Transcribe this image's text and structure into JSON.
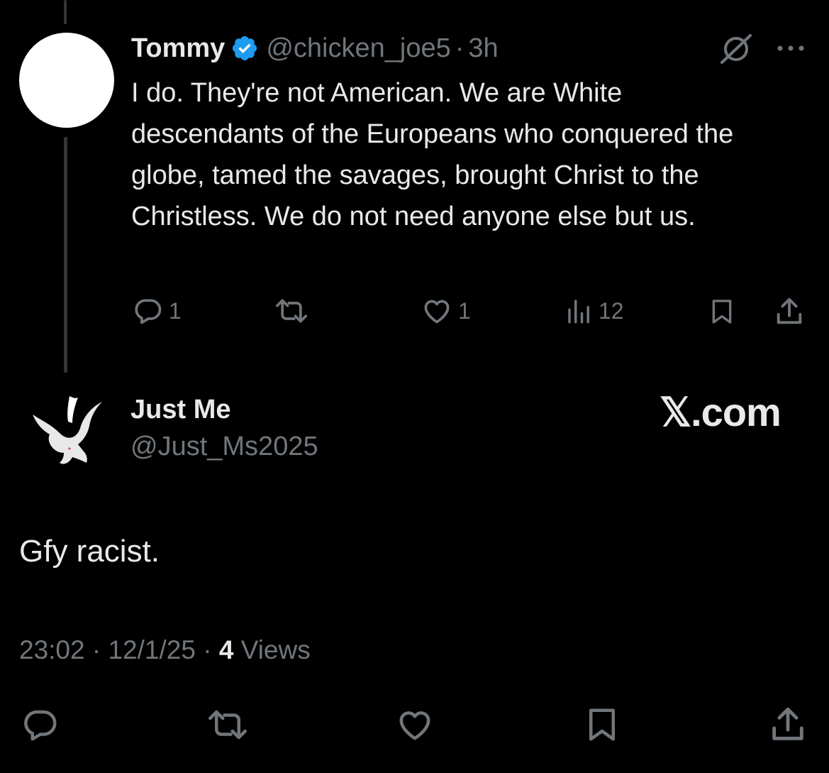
{
  "parent_tweet": {
    "display_name": "Tommy",
    "handle": "@chicken_joe5",
    "separator": "·",
    "time": "3h",
    "text": "I do. They're not American. We are White descendants of the Europeans who conquered the globe, tamed the savages, brought Christ to the Christless. We do not need anyone else but us.",
    "replies": "1",
    "likes": "1",
    "views": "12"
  },
  "reply_tweet": {
    "display_name": "Just Me",
    "handle": "@Just_Ms2025",
    "text": "Gfy racist.",
    "time": "23:02",
    "dot1": "·",
    "date": "12/1/25",
    "dot2": "·",
    "views_count": "4",
    "views_label": "Views"
  },
  "watermark": "𝕏.com",
  "colors": {
    "background": "#000000",
    "text_primary": "#e7e9ea",
    "text_secondary": "#71767b",
    "verified": "#1d9bf0",
    "thread_line": "#333639"
  },
  "icons": [
    "reply-icon",
    "retweet-icon",
    "like-icon",
    "views-icon",
    "bookmark-icon",
    "share-icon",
    "grok-icon",
    "more-icon",
    "verified-icon"
  ]
}
